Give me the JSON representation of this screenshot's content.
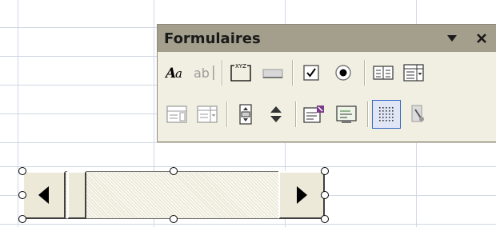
{
  "toolbar": {
    "title": "Formulaires",
    "menu_icon": "chevron-down-icon",
    "close_icon": "close-icon",
    "row1_tools": [
      {
        "name": "label-tool-icon",
        "glyph": "Aa"
      },
      {
        "name": "edit-box-tool-icon",
        "glyph": "ab|"
      },
      {
        "name": "group-box-tool-icon",
        "glyph": "XYZ"
      },
      {
        "name": "button-tool-icon"
      },
      {
        "name": "checkbox-tool-icon"
      },
      {
        "name": "option-button-tool-icon"
      },
      {
        "name": "list-box-tool-icon"
      },
      {
        "name": "combo-box-tool-icon"
      }
    ],
    "row2_tools": [
      {
        "name": "combination-list-edit-icon"
      },
      {
        "name": "combination-dropdown-edit-icon"
      },
      {
        "name": "scroll-bar-tool-icon"
      },
      {
        "name": "spinner-tool-icon"
      },
      {
        "name": "control-properties-icon"
      },
      {
        "name": "edit-code-icon"
      },
      {
        "name": "toggle-grid-icon",
        "active": true
      },
      {
        "name": "run-dialog-icon"
      }
    ]
  },
  "control": {
    "type": "scroll-bar",
    "selected": true,
    "left_arrow": "left-arrow-icon",
    "right_arrow": "right-arrow-icon"
  },
  "colors": {
    "title_bar": "#a39f8c",
    "toolbar_bg": "#f1efe2",
    "grid_line": "#d0d7e5",
    "active_border": "#3165c4"
  }
}
